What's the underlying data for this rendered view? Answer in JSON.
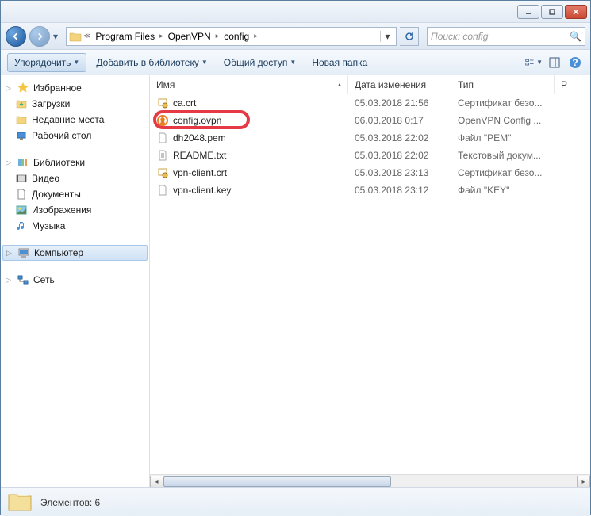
{
  "titlebar": {},
  "nav": {
    "crumbs": [
      "Program Files",
      "OpenVPN",
      "config"
    ],
    "search_placeholder": "Поиск: config"
  },
  "toolbar": {
    "organize": "Упорядочить",
    "addlib": "Добавить в библиотеку",
    "share": "Общий доступ",
    "newfolder": "Новая папка"
  },
  "sidebar": {
    "favorites": {
      "label": "Избранное",
      "items": [
        "Загрузки",
        "Недавние места",
        "Рабочий стол"
      ]
    },
    "libraries": {
      "label": "Библиотеки",
      "items": [
        "Видео",
        "Документы",
        "Изображения",
        "Музыка"
      ]
    },
    "computer": "Компьютер",
    "network": "Сеть"
  },
  "columns": {
    "name": "Имя",
    "date": "Дата изменения",
    "type": "Тип",
    "size": "Р"
  },
  "files": [
    {
      "name": "ca.crt",
      "date": "05.03.2018 21:56",
      "type": "Сертификат безо...",
      "icon": "cert"
    },
    {
      "name": "config.ovpn",
      "date": "06.03.2018 0:17",
      "type": "OpenVPN Config ...",
      "icon": "ovpn",
      "highlighted": true
    },
    {
      "name": "dh2048.pem",
      "date": "05.03.2018 22:02",
      "type": "Файл \"PEM\"",
      "icon": "file"
    },
    {
      "name": "README.txt",
      "date": "05.03.2018 22:02",
      "type": "Текстовый докум...",
      "icon": "txt"
    },
    {
      "name": "vpn-client.crt",
      "date": "05.03.2018 23:13",
      "type": "Сертификат безо...",
      "icon": "cert"
    },
    {
      "name": "vpn-client.key",
      "date": "05.03.2018 23:12",
      "type": "Файл \"KEY\"",
      "icon": "file"
    }
  ],
  "status": {
    "count_label": "Элементов: 6"
  }
}
